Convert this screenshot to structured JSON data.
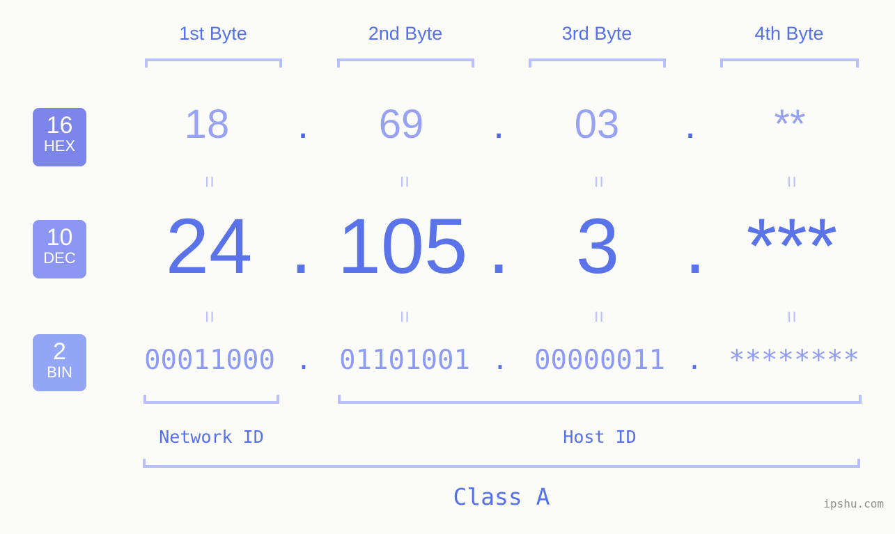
{
  "meta": {
    "background_color": "#fbfcf7",
    "accent_color": "#5570ee",
    "accent_light": "#b7c0fb",
    "watermark": "ipshu.com"
  },
  "byte_headers": [
    {
      "label": "1st Byte"
    },
    {
      "label": "2nd Byte"
    },
    {
      "label": "3rd Byte"
    },
    {
      "label": "4th Byte"
    }
  ],
  "bases": [
    {
      "number": "16",
      "abbr": "HEX",
      "color": "#7b85ea"
    },
    {
      "number": "10",
      "abbr": "DEC",
      "color": "#8b96f2"
    },
    {
      "number": "2",
      "abbr": "BIN",
      "color": "#93a6f6"
    }
  ],
  "rows": {
    "hex": {
      "values": [
        "18",
        "69",
        "03",
        "**"
      ],
      "separator": "."
    },
    "dec": {
      "values": [
        "24",
        "105",
        "3",
        "***"
      ],
      "separator": "."
    },
    "bin": {
      "values": [
        "00011000",
        "01101001",
        "00000011",
        "********"
      ],
      "separator": "."
    }
  },
  "equals_symbol": "=",
  "segments": {
    "network": "Network ID",
    "host": "Host ID"
  },
  "class": {
    "label": "Class A"
  }
}
